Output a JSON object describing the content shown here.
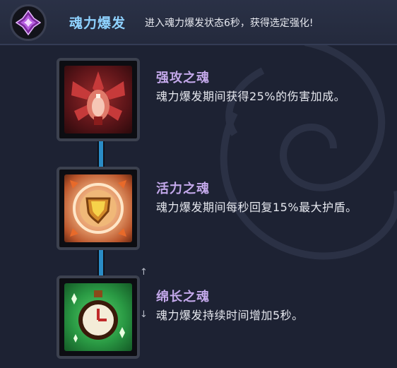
{
  "header": {
    "title": "魂力爆发",
    "description": "进入魂力爆发状态6秒，获得选定强化!",
    "icon": "purple-crystal-icon"
  },
  "talents": [
    {
      "name": "强攻之魂",
      "description": "魂力爆发期间获得25%的伤害加成。",
      "icon": "red-beast-claw-icon"
    },
    {
      "name": "活力之魂",
      "description": "魂力爆发期间每秒回复15%最大护盾。",
      "icon": "golden-shield-icon"
    },
    {
      "name": "绵长之魂",
      "description": "魂力爆发持续时间增加5秒。",
      "icon": "green-stopwatch-icon"
    }
  ],
  "scroll": {
    "up": "↑",
    "down": "↓"
  },
  "colors": {
    "background": "#1d2233",
    "title_accent": "#8fd2ff",
    "talent_name": "#c3a8ea",
    "connector": "#2a8cc6"
  }
}
